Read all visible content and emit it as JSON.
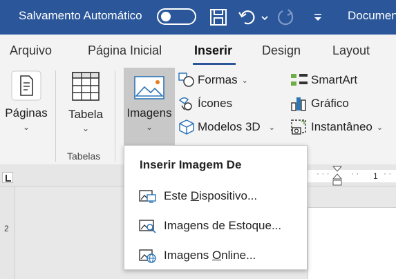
{
  "titlebar": {
    "autosave_label": "Salvamento Automático",
    "autosave_on": false,
    "document_title": "Documen"
  },
  "tabs": [
    {
      "label": "Arquivo",
      "active": false
    },
    {
      "label": "Página Inicial",
      "active": false
    },
    {
      "label": "Inserir",
      "active": true
    },
    {
      "label": "Design",
      "active": false
    },
    {
      "label": "Layout",
      "active": false
    }
  ],
  "ribbon": {
    "paginas": "Páginas",
    "tabela": "Tabela",
    "imagens": "Imagens",
    "tabelas_group": "Tabelas",
    "formas": "Formas",
    "icones": "Ícones",
    "modelos3d": "Modelos 3D",
    "smartart": "SmartArt",
    "grafico": "Gráfico",
    "instantaneo": "Instantâneo"
  },
  "ruler": {
    "h_mark": "1",
    "v_mark": "2"
  },
  "dropdown": {
    "header": "Inserir Imagem De",
    "items": [
      {
        "pre": "Este ",
        "ul": "D",
        "post": "ispositivo...",
        "icon": "device-image-icon"
      },
      {
        "pre": "Imagens de Estoque...",
        "ul": "",
        "post": "",
        "icon": "stock-image-icon"
      },
      {
        "pre": "Imagens ",
        "ul": "O",
        "post": "nline...",
        "icon": "online-image-icon"
      }
    ]
  },
  "colors": {
    "accent": "#2b579a",
    "ribbon_bg": "#f3f3f3",
    "selected_button": "#c8c8c8"
  }
}
